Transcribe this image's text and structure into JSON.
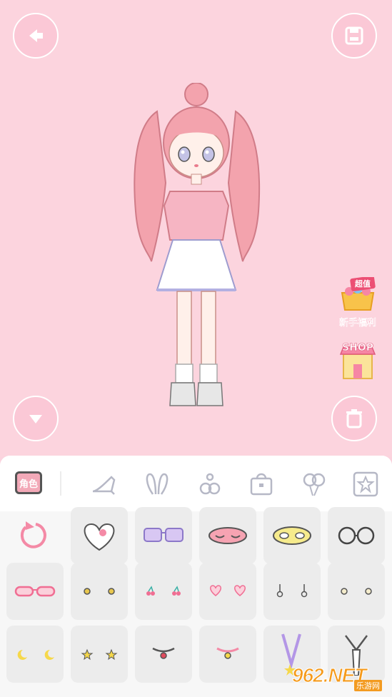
{
  "stage": {
    "background": "#fcd4de",
    "promo_badge_top": "超值",
    "promo_label": "新手福利",
    "shop_label": "SHOP"
  },
  "buttons": {
    "back": "back-arrow-icon",
    "save": "save-icon",
    "collapse": "chevron-down-icon",
    "delete": "trash-icon"
  },
  "tabs": {
    "role_label": "角色",
    "items": [
      "shoe-icon",
      "bunny-ears-icon",
      "flower-clip-icon",
      "bag-icon",
      "balloon-icon",
      "sticker-icon"
    ]
  },
  "grid": {
    "rows": [
      [
        "reset",
        "heart-fluffy-clip",
        "purple-sunglasses",
        "pink-sleep-mask",
        "yellow-sleep-mask",
        "round-glasses"
      ],
      [
        "pink-glasses",
        "gold-stud-earrings",
        "cherry-earrings",
        "heart-earrings",
        "dangle-earrings",
        "pearl-earrings"
      ],
      [
        "moon-earrings",
        "star-earrings",
        "choker-red",
        "choker-pink",
        "star-lanyard",
        "tie-necklace"
      ]
    ]
  },
  "watermark": {
    "logo": "962.NET",
    "sub": "乐游网"
  }
}
